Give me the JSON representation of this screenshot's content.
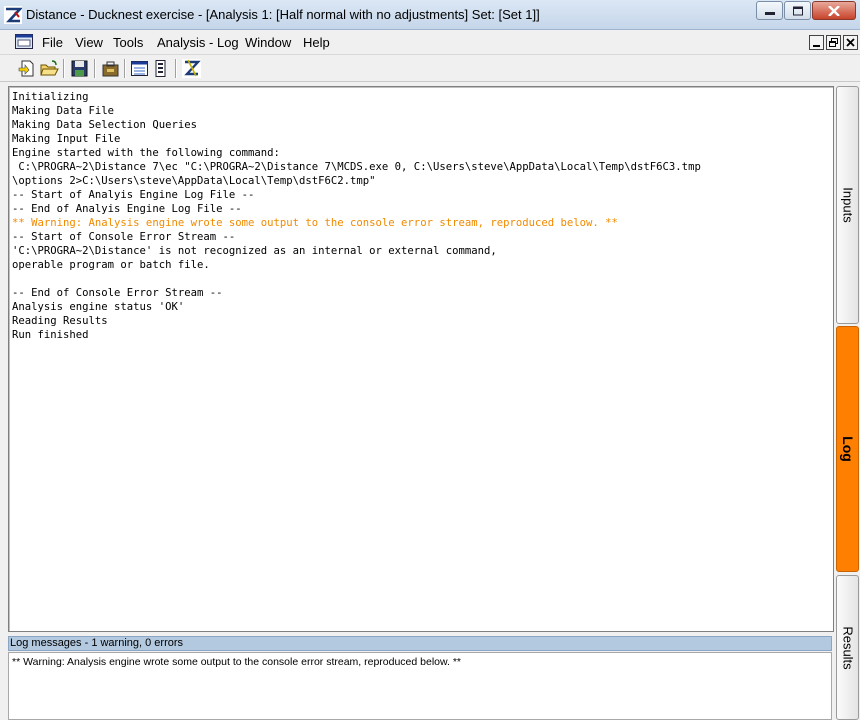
{
  "window": {
    "title": "Distance - Ducknest exercise - [Analysis 1: [Half normal with no adjustments] Set: [Set 1]]",
    "accent": "#ff7f00",
    "buttons": [
      "minimize-icon",
      "maximize-icon",
      "close-icon"
    ]
  },
  "menu": {
    "items": [
      {
        "label": "File"
      },
      {
        "label": "View"
      },
      {
        "label": "Tools"
      },
      {
        "label": "Analysis - Log"
      },
      {
        "label": "Window"
      },
      {
        "label": "Help"
      }
    ]
  },
  "toolbar": {
    "buttons": [
      "new-project-icon",
      "open-project-icon",
      "save-icon",
      "data-explorer-icon",
      "analysis-browser-icon",
      "analysis-details-icon",
      "distance-logo-icon"
    ]
  },
  "log": {
    "lines": [
      {
        "text": "Initializing",
        "warn": false
      },
      {
        "text": "Making Data File",
        "warn": false
      },
      {
        "text": "Making Data Selection Queries",
        "warn": false
      },
      {
        "text": "Making Input File",
        "warn": false
      },
      {
        "text": "Engine started with the following command:",
        "warn": false
      },
      {
        "text": " C:\\PROGRA~2\\Distance 7\\ec \"C:\\PROGRA~2\\Distance 7\\MCDS.exe 0, C:\\Users\\steve\\AppData\\Local\\Temp\\dstF6C3.tmp",
        "warn": false
      },
      {
        "text": "\\options 2>C:\\Users\\steve\\AppData\\Local\\Temp\\dstF6C2.tmp\"",
        "warn": false
      },
      {
        "text": "-- Start of Analyis Engine Log File --",
        "warn": false
      },
      {
        "text": "-- End of Analyis Engine Log File --",
        "warn": false
      },
      {
        "text": "** Warning: Analysis engine wrote some output to the console error stream, reproduced below. **",
        "warn": true
      },
      {
        "text": "-- Start of Console Error Stream --",
        "warn": false
      },
      {
        "text": "'C:\\PROGRA~2\\Distance' is not recognized as an internal or external command,",
        "warn": false
      },
      {
        "text": "operable program or batch file.",
        "warn": false
      },
      {
        "text": "",
        "warn": false
      },
      {
        "text": "-- End of Console Error Stream --",
        "warn": false
      },
      {
        "text": "Analysis engine status 'OK'",
        "warn": false
      },
      {
        "text": "Reading Results",
        "warn": false
      },
      {
        "text": "Run finished",
        "warn": false
      }
    ]
  },
  "messages": {
    "header": "Log messages - 1 warning, 0 errors",
    "items": [
      "** Warning: Analysis engine wrote some output to the console error stream, reproduced below. **"
    ]
  },
  "side_tabs": [
    {
      "label": "Inputs",
      "active": false
    },
    {
      "label": "Log",
      "active": true
    },
    {
      "label": "Results",
      "active": false
    }
  ]
}
